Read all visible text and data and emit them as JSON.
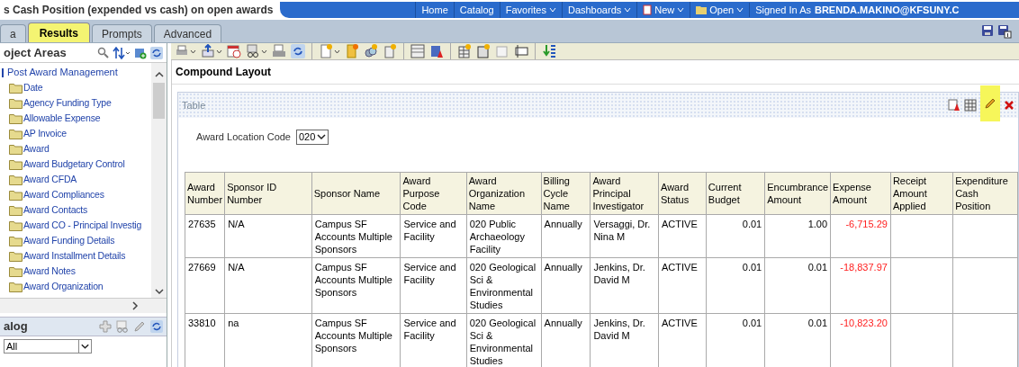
{
  "window": {
    "title": "s Cash Position (expended vs cash) on open awards"
  },
  "nav": [
    {
      "label": "Home",
      "dropdown": false,
      "kind": "plain"
    },
    {
      "label": "Catalog",
      "dropdown": false,
      "kind": "plain"
    },
    {
      "label": "Favorites",
      "dropdown": true,
      "kind": "plain"
    },
    {
      "label": "Dashboards",
      "dropdown": true,
      "kind": "plain"
    },
    {
      "label": "New",
      "dropdown": true,
      "kind": "document"
    },
    {
      "label": "Open",
      "dropdown": true,
      "kind": "folder"
    }
  ],
  "signed_in": {
    "label": "Signed In As",
    "user": "BRENDA.MAKINO@KFSUNY.C"
  },
  "tabs": [
    {
      "label": "a",
      "selected": false
    },
    {
      "label": "Results",
      "selected": true
    },
    {
      "label": "Prompts",
      "selected": false
    },
    {
      "label": "Advanced",
      "selected": false
    }
  ],
  "subject_areas": {
    "title": "oject Areas",
    "tree": {
      "label": "Post Award Management",
      "children": [
        {
          "label": "Date"
        },
        {
          "label": "Agency Funding Type"
        },
        {
          "label": "Allowable Expense"
        },
        {
          "label": "AP Invoice"
        },
        {
          "label": "Award"
        },
        {
          "label": "Award Budgetary Control"
        },
        {
          "label": "Award CFDA"
        },
        {
          "label": "Award Compliances"
        },
        {
          "label": "Award Contacts"
        },
        {
          "label": "Award CO - Principal Investig"
        },
        {
          "label": "Award Funding Details"
        },
        {
          "label": "Award Installment Details"
        },
        {
          "label": "Award Notes"
        },
        {
          "label": "Award Organization"
        }
      ]
    }
  },
  "catalog": {
    "title": "alog",
    "filter": "All"
  },
  "layout": {
    "title": "Compound Layout"
  },
  "view": {
    "title": "Table",
    "edit_highlighted": true
  },
  "prompt": {
    "label": "Award Location Code",
    "value": "020"
  },
  "table": {
    "columns": [
      {
        "label": "Award Number",
        "kind": "text"
      },
      {
        "label": "Sponsor ID Number",
        "kind": "text"
      },
      {
        "label": "Sponsor Name",
        "kind": "text"
      },
      {
        "label": "Award Purpose Code",
        "kind": "text"
      },
      {
        "label": "Award Organization Name",
        "kind": "text"
      },
      {
        "label": "Billing Cycle Name",
        "kind": "text"
      },
      {
        "label": "Award Principal Investigator",
        "kind": "text"
      },
      {
        "label": "Award Status",
        "kind": "text"
      },
      {
        "label": "Current Budget",
        "kind": "number"
      },
      {
        "label": "Encumbrance Amount",
        "kind": "number"
      },
      {
        "label": "Expense Amount",
        "kind": "negative"
      },
      {
        "label": "Receipt Amount Applied",
        "kind": "number"
      },
      {
        "label": "Expenditure Cash Position",
        "kind": "number"
      }
    ],
    "rows": [
      [
        "27635",
        "N/A",
        "Campus SF Accounts Multiple Sponsors",
        "Service and Facility",
        "020 Public Archaeology Facility",
        "Annually",
        "Versaggi, Dr. Nina M",
        "ACTIVE",
        "0.01",
        "1.00",
        "-6,715.29",
        "",
        ""
      ],
      [
        "27669",
        "N/A",
        "Campus SF Accounts Multiple Sponsors",
        "Service and Facility",
        "020 Geological Sci & Environmental Studies",
        "Annually",
        "Jenkins, Dr. David M",
        "ACTIVE",
        "0.01",
        "0.01",
        "-18,837.97",
        "",
        ""
      ],
      [
        "33810",
        "na",
        "Campus SF Accounts Multiple Sponsors",
        "Service and Facility",
        "020 Geological Sci & Environmental Studies",
        "Annually",
        "Jenkins, Dr. David M",
        "ACTIVE",
        "0.01",
        "0.01",
        "-10,823.20",
        "",
        ""
      ]
    ]
  }
}
